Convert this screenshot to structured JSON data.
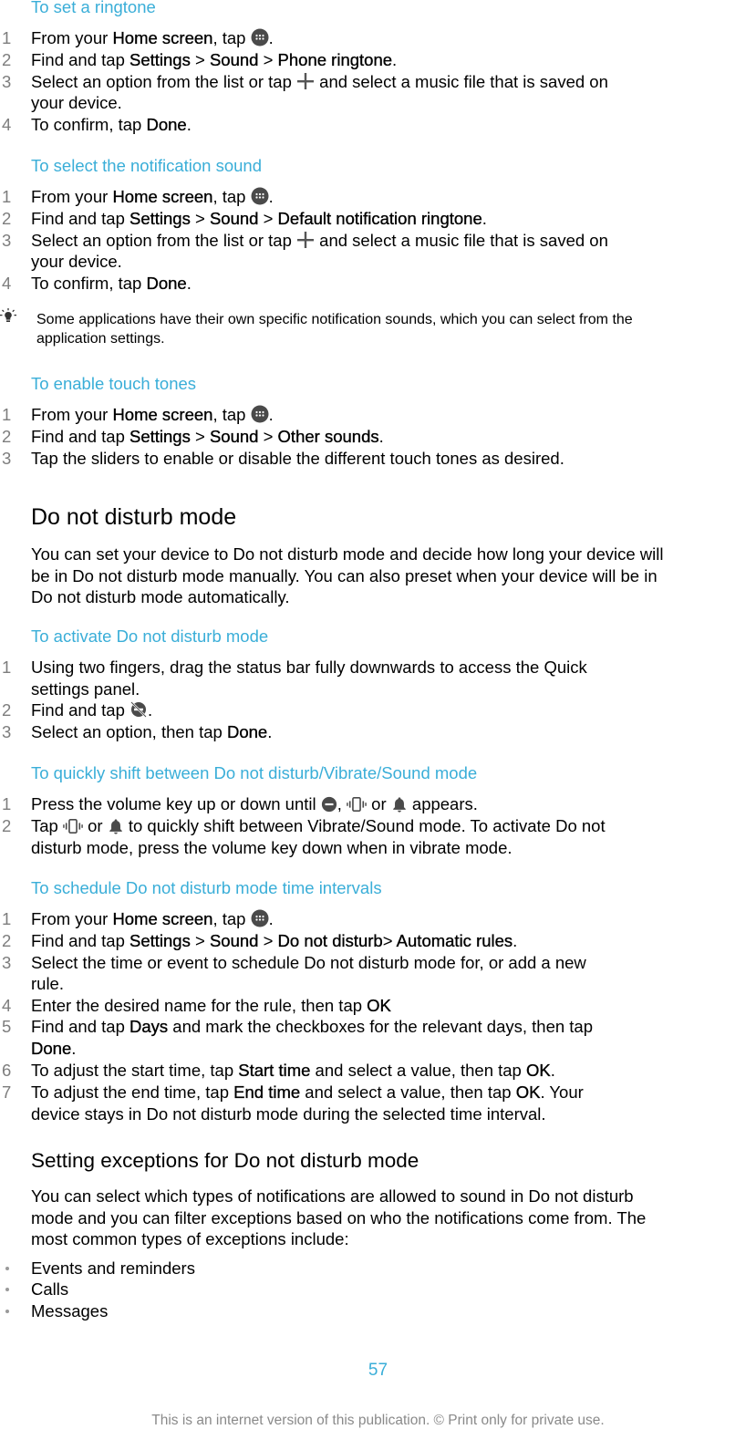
{
  "sections": {
    "ringtone": {
      "title": "To set a ringtone",
      "steps": [
        {
          "num": "1",
          "pre": "From your ",
          "b1": "Home screen",
          "mid": ", tap ",
          "post": "."
        },
        {
          "num": "2",
          "pre": "Find and tap ",
          "b1": "Settings",
          "s1": " > ",
          "b2": "Sound",
          "s2": " > ",
          "b3": "Phone ringtone",
          "post": "."
        },
        {
          "num": "3",
          "pre": "Select an option from the list or tap ",
          "post": " and select a music file that is saved on",
          "cont": "your device."
        },
        {
          "num": "4",
          "pre": "To confirm, tap ",
          "b1": "Done",
          "post": "."
        }
      ]
    },
    "notification": {
      "title": "To select the notification sound",
      "steps": [
        {
          "num": "1",
          "pre": "From your ",
          "b1": "Home screen",
          "mid": ", tap ",
          "post": "."
        },
        {
          "num": "2",
          "pre": "Find and tap ",
          "b1": "Settings",
          "s1": " > ",
          "b2": "Sound",
          "s2": " > ",
          "b3": "Default notification ringtone",
          "post": "."
        },
        {
          "num": "3",
          "pre": "Select an option from the list or tap ",
          "post": " and select a music file that is saved on",
          "cont": "your device."
        },
        {
          "num": "4",
          "pre": "To confirm, tap ",
          "b1": "Done",
          "post": "."
        }
      ],
      "tip_line1": "Some applications have their own specific notification sounds, which you can select from the",
      "tip_line2": "application settings."
    },
    "touch": {
      "title": "To enable touch tones",
      "steps": [
        {
          "num": "1",
          "pre": "From your ",
          "b1": "Home screen",
          "mid": ", tap ",
          "post": "."
        },
        {
          "num": "2",
          "pre": "Find and tap ",
          "b1": "Settings",
          "s1": " > ",
          "b2": "Sound",
          "s2": " > ",
          "b3": "Other sounds",
          "post": "."
        },
        {
          "num": "3",
          "pre": "Tap the sliders to enable or disable the different touch tones as desired."
        }
      ]
    },
    "dnd": {
      "heading": "Do not disturb mode",
      "para": [
        "You can set your device to Do not disturb mode and decide how long your device will",
        "be in Do not disturb mode manually. You can also preset when your device will be in",
        "Do not disturb mode automatically."
      ]
    },
    "activate": {
      "title": "To activate Do not disturb mode",
      "steps": [
        {
          "num": "1",
          "pre": "Using two fingers, drag the status bar fully downwards to access the Quick",
          "cont": "settings panel."
        },
        {
          "num": "2",
          "pre": "Find and tap ",
          "post": "."
        },
        {
          "num": "3",
          "pre": "Select an option, then tap ",
          "b1": "Done",
          "post": "."
        }
      ]
    },
    "shift": {
      "title": "To quickly shift between Do not disturb/Vibrate/Sound mode",
      "steps": [
        {
          "num": "1",
          "pre": "Press the volume key up or down until ",
          "c1": ", ",
          "c2": " or ",
          "post": " appears."
        },
        {
          "num": "2",
          "pre": "Tap ",
          "c1": " or ",
          "post": " to quickly shift between Vibrate/Sound mode. To activate Do not",
          "cont": "disturb mode, press the volume key down when in vibrate mode."
        }
      ]
    },
    "schedule": {
      "title": "To schedule Do not disturb mode time intervals",
      "steps": [
        {
          "num": "1",
          "pre": "From your ",
          "b1": "Home screen",
          "mid": ", tap ",
          "post": "."
        },
        {
          "num": "2",
          "pre": "Find and tap ",
          "b1": "Settings",
          "s1": " > ",
          "b2": "Sound",
          "s2": " > ",
          "b3": "Do not disturb",
          "s3": "> ",
          "b4": "Automatic rules",
          "post": "."
        },
        {
          "num": "3",
          "pre": "Select the time or event to schedule Do not disturb mode for, or add a new",
          "cont": "rule."
        },
        {
          "num": "4",
          "pre": "Enter the desired name for the rule, then tap ",
          "b1": "OK"
        },
        {
          "num": "5",
          "pre": "Find and tap ",
          "b1": "Days",
          "post": " and mark the checkboxes for the relevant days, then tap",
          "cont_b": "Done",
          "cont_post": "."
        },
        {
          "num": "6",
          "pre": "To adjust the start time, tap ",
          "b1": "Start time",
          "mid": " and select a value, then tap ",
          "b2": "OK",
          "post": "."
        },
        {
          "num": "7",
          "pre": "To adjust the end time, tap ",
          "b1": "End time",
          "mid": " and select a value, then tap ",
          "b2": "OK",
          "post": ". Your",
          "cont": "device stays in Do not disturb mode during the selected time interval."
        }
      ]
    },
    "exceptions": {
      "heading": "Setting exceptions for Do not disturb mode",
      "para": [
        "You can select which types of notifications are allowed to sound in Do not disturb",
        "mode and you can filter exceptions based on who the notifications come from. The",
        "most common types of exceptions include:"
      ],
      "bullets": [
        "Events and reminders",
        "Calls",
        "Messages"
      ]
    }
  },
  "footer": {
    "page_number": "57",
    "notice": "This is an internet version of this publication. © Print only for private use."
  },
  "colors": {
    "accent": "#3aaed8",
    "step_number": "#7d7d7d",
    "footer_text": "#8a8a8a"
  }
}
